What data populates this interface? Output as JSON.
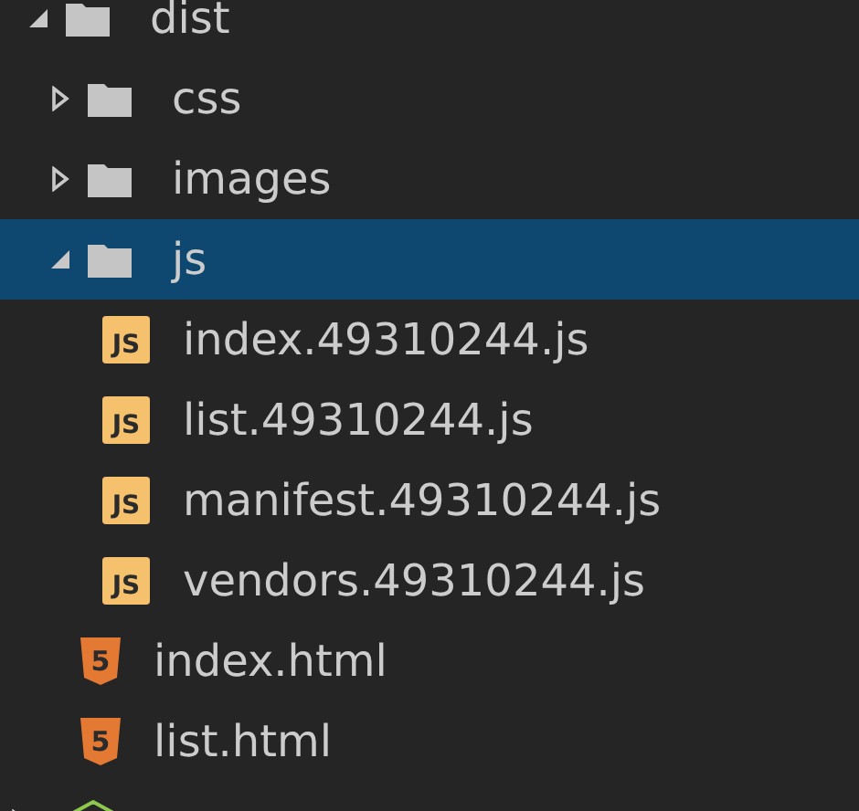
{
  "tree": [
    {
      "kind": "folder",
      "name": "dist",
      "expanded": true,
      "selected": false,
      "children": [
        {
          "kind": "folder",
          "name": "css",
          "expanded": false,
          "selected": false
        },
        {
          "kind": "folder",
          "name": "images",
          "expanded": false,
          "selected": false
        },
        {
          "kind": "folder",
          "name": "js",
          "expanded": true,
          "selected": true,
          "children": [
            {
              "kind": "js",
              "badge": "JS",
              "name": "index.49310244.js",
              "selected": false
            },
            {
              "kind": "js",
              "badge": "JS",
              "name": "list.49310244.js",
              "selected": false
            },
            {
              "kind": "js",
              "badge": "JS",
              "name": "manifest.49310244.js",
              "selected": false
            },
            {
              "kind": "js",
              "badge": "JS",
              "name": "vendors.49310244.js",
              "selected": false
            }
          ]
        },
        {
          "kind": "html",
          "badge": "5",
          "name": "index.html",
          "selected": false
        },
        {
          "kind": "html",
          "badge": "5",
          "name": "list.html",
          "selected": false
        }
      ]
    },
    {
      "kind": "node",
      "expanded": false,
      "selected": false
    }
  ]
}
